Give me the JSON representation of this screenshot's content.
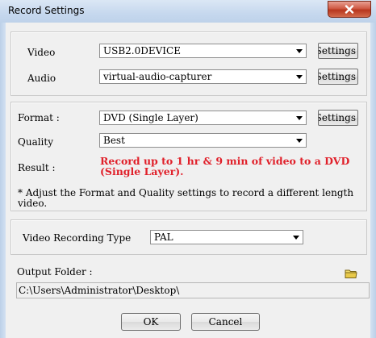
{
  "window": {
    "title": "Record Settings"
  },
  "devices": {
    "video_label": "Video",
    "video_value": "USB2.0DEVICE",
    "audio_label": "Audio",
    "audio_value": "virtual-audio-capturer",
    "video_settings_label": "Settings",
    "audio_settings_label": "Settings"
  },
  "format": {
    "format_label": "Format :",
    "format_value": "DVD (Single Layer)",
    "format_settings_label": "Settings",
    "quality_label": "Quality",
    "quality_value": "Best",
    "result_label": "Result :",
    "result_text": "Record up to 1 hr & 9 min of  video to a DVD (Single Layer).",
    "note": "* Adjust the Format and Quality settings to record a different length video."
  },
  "recording_type": {
    "label": "Video Recording Type",
    "value": "PAL"
  },
  "output": {
    "label": "Output Folder :",
    "path": "C:\\Users\\Administrator\\Desktop\\"
  },
  "buttons": {
    "ok": "OK",
    "cancel": "Cancel"
  },
  "icons": {
    "close": "close-icon",
    "folder": "folder-icon",
    "dropdown": "chevron-down-icon"
  },
  "colors": {
    "result_text": "#e0202a",
    "close_button": "#c8462d",
    "folder": "#e8c94a"
  }
}
